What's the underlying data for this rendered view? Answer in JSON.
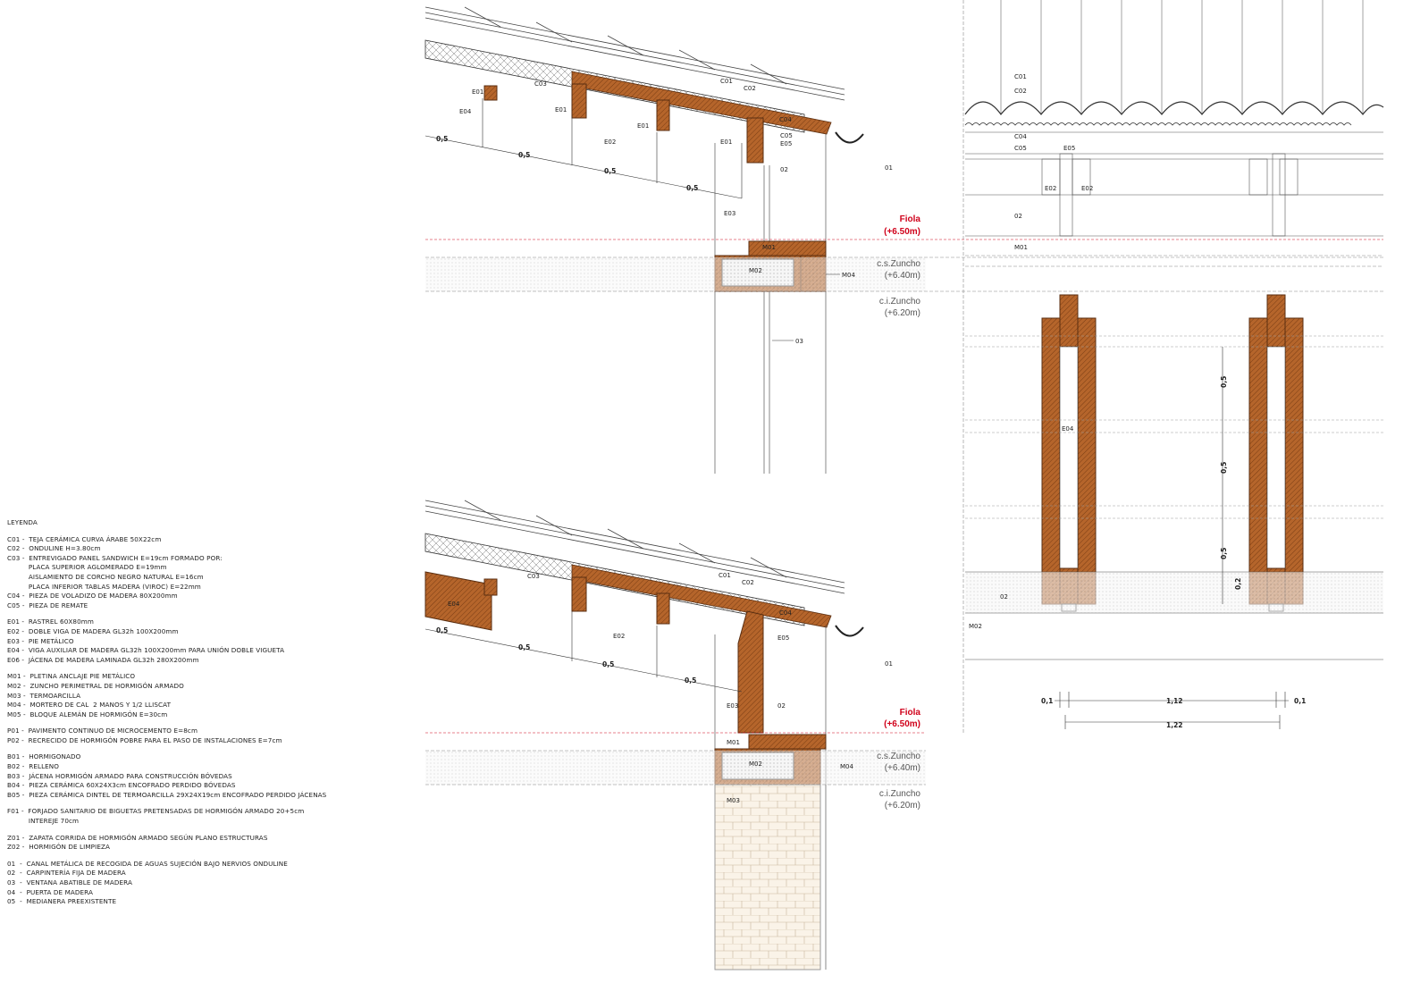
{
  "legend": {
    "title": "LEYENDA",
    "groups": [
      [
        "C01 -  TEJA CERÁMICA CURVA ÁRABE 50X22cm",
        "C02 -  ONDULINE H=3.80cm",
        "C03 -  ENTREVIGADO PANEL SANDWICH E=19cm FORMADO POR:",
        "          PLACA SUPERIOR AGLOMERADO E=19mm",
        "          AISLAMIENTO DE CORCHO NEGRO NATURAL E=16cm",
        "          PLACA INFERIOR TABLAS MADERA (VIROC) E=22mm",
        "C04 -  PIEZA DE VOLADIZO DE MADERA 80X200mm",
        "C05 -  PIEZA DE REMATE"
      ],
      [
        "E01 -  RASTREL 60X80mm",
        "E02 -  DOBLE VIGA DE MADERA GL32h 100X200mm",
        "E03 -  PIE METÁLICO",
        "E04 -  VIGA AUXILIAR DE MADERA GL32h 100X200mm PARA UNIÓN DOBLE VIGUETA",
        "E06 -  JÁCENA DE MADERA LAMINADA GL32h 280X200mm"
      ],
      [
        "M01 -  PLETINA ANCLAJE PIE METÁLICO",
        "M02 -  ZUNCHO PERIMETRAL DE HORMIGÓN ARMADO",
        "M03 -  TERMOARCILLA",
        "M04 -  MORTERO DE CAL  2 MANOS Y 1/2 LLISCAT",
        "M05 -  BLOQUE ALEMÁN DE HORMIGÓN E=30cm"
      ],
      [
        "P01 -  PAVIMENTO CONTINUO DE MICROCEMENTO E=8cm",
        "P02 -  RECRECIDO DE HORMIGÓN POBRE PARA EL PASO DE INSTALACIONES E=7cm"
      ],
      [
        "B01 -  HORMIGONADO",
        "B02 -  RELLENO",
        "B03 -  JÁCENA HORMIGÓN ARMADO PARA CONSTRUCCIÓN BÓVEDAS",
        "B04 -  PIEZA CERÁMICA 60X24X3cm ENCOFRADO PERDIDO BÓVEDAS",
        "B05 -  PIEZA CERÁMICA DINTEL DE TERMOARCILLA 29X24X19cm ENCOFRADO PERDIDO JÁCENAS"
      ],
      [
        "F01 -  FORJADO SANITARIO DE BIGUETAS PRETENSADAS DE HORMIGÓN ARMADO 20+5cm",
        "          INTEREJE 70cm"
      ],
      [
        "Z01 -  ZAPATA CORRIDA DE HORMIGÓN ARMADO SEGÚN PLANO ESTRUCTURAS",
        "Z02 -  HORMIGÓN DE LIMPIEZA"
      ],
      [
        "01  -  CANAL METÁLICA DE RECOGIDA DE AGUAS SUJECIÓN BAJO NERVIOS ONDULINE",
        "02  -  CARPINTERÍA FIJA DE MADERA",
        "03  -  VENTANA ABATIBLE DE MADERA",
        "04  -  PUERTA DE MADERA",
        "05  -  MEDIANERA PREEXISTENTE"
      ]
    ]
  },
  "levels": {
    "fiola": "Fiola",
    "fiola_value": "(+6.50m)",
    "cs_zuncho": "c.s.Zuncho",
    "cs_value": "(+6.40m)",
    "ci_zuncho": "c.i.Zuncho",
    "ci_value": "(+6.20m)"
  },
  "labels": {
    "c01": "C01",
    "c02": "C02",
    "c03": "C03",
    "c04": "C04",
    "c05": "C05",
    "e01": "E01",
    "e02": "E02",
    "e03": "E03",
    "e04": "E04",
    "e05": "E05",
    "m01": "M01",
    "m02": "M02",
    "m03": "M03",
    "m04": "M04",
    "n01": "01",
    "n02": "02",
    "n03": "03"
  },
  "dims": {
    "d05": "0,5",
    "d02": "0,2",
    "d01": "0,1",
    "d112": "1,12",
    "d122": "1,22"
  },
  "colors": {
    "wood": "#b5652b",
    "wood_dark": "#5a2e10",
    "level_red": "#d0021b",
    "line": "#333333"
  }
}
